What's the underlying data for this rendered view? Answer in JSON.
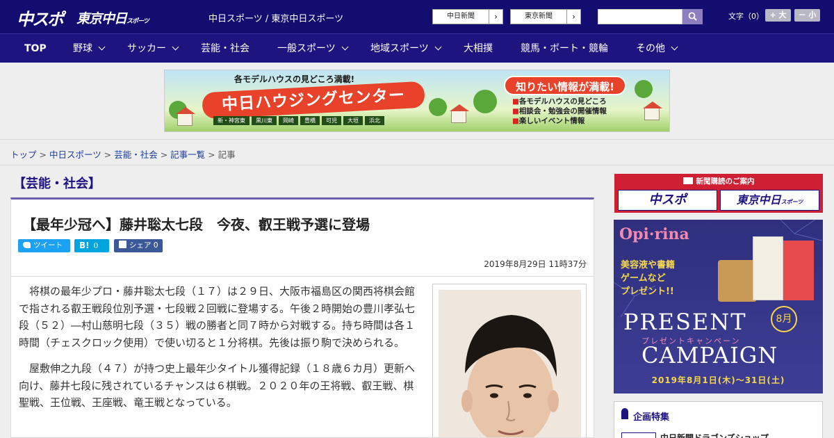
{
  "header": {
    "logo_main": "中スポ",
    "logo_tokyo": "東京中日",
    "logo_tokyo_small": "スポーツ",
    "site_names": "中日スポーツ / 東京中日スポーツ",
    "ext_links": [
      {
        "label": "中日新聞"
      },
      {
        "label": "東京新聞"
      }
    ],
    "search": {
      "value": "",
      "placeholder": ""
    },
    "font_size_label": "文字（0）",
    "font_up": "+ 大",
    "font_down": "－ 小"
  },
  "nav": {
    "items": [
      {
        "label": "TOP"
      },
      {
        "label": "野球"
      },
      {
        "label": "サッカー"
      },
      {
        "label": "芸能・社会"
      },
      {
        "label": "一般スポーツ"
      },
      {
        "label": "地域スポーツ"
      },
      {
        "label": "大相撲"
      },
      {
        "label": "競馬・ボート・競輪"
      },
      {
        "label": "その他"
      }
    ]
  },
  "banner": {
    "top_text": "各モデルハウスの見どころ満載!",
    "main_text": "中日ハウジングセンター",
    "areas": [
      "新・神宮東",
      "黒川東",
      "岡崎",
      "豊橋",
      "可児",
      "大垣",
      "浜北"
    ],
    "bubble": "知りたい情報が満載!",
    "features": [
      "各モデルハウスの見どころ",
      "相談会・勉強会の開催情報",
      "楽しいイベント情報"
    ]
  },
  "breadcrumb": {
    "items": [
      "トップ",
      "中日スポーツ",
      "芸能・社会",
      "記事一覧"
    ],
    "current": "記事",
    "separator": ">"
  },
  "category_title": "【芸能・社会】",
  "article": {
    "title": "【最年少冠へ】藤井聡太七段　今夜、叡王戦予選に登場",
    "share": {
      "tweet": "ツイート",
      "hatena_label": "B!",
      "hatena_count": "0",
      "facebook": "シェア 0"
    },
    "date": "2019年8月29日 11時37分",
    "paragraphs": [
      "将棋の最年少プロ・藤井聡太七段（１７）は２９日、大阪市福島区の関西将棋会館で指される叡王戦段位別予選・七段戦２回戦に登場する。午後２時開始の豊川孝弘七段（５２）―村山慈明七段（３５）戦の勝者と同７時から対戦する。持ち時間は各１時間（チェスクロック使用）で使い切ると１分将棋。先後は振り駒で決められる。",
      "屋敷伸之九段（４７）が持つ史上最年少タイトル獲得記録（１８歳６カ月）更新へ向け、藤井七段に残されているチャンスは６棋戦。２０２０年の王将戦、叡王戦、棋聖戦、王位戦、王座戦、竜王戦となっている。"
    ]
  },
  "sidebar": {
    "subscription": {
      "head": "新聞購読のご案内",
      "logo1": "中スポ",
      "logo2": "東京中日",
      "logo2_small": "スポーツ"
    },
    "ad": {
      "brand": "Opi·rina",
      "gift_lines": [
        "美容液や書籍",
        "ゲームなど",
        "プレゼント!!"
      ],
      "present": "PRESENT",
      "sub": "プレゼントキャンペーン",
      "campaign": "CAMPAIGN",
      "month": "8月",
      "date_range": "2019年8月1日(木)～31日(土)"
    },
    "feature": {
      "title": "企画特集",
      "item": "中日新聞ドラゴンズショップ"
    }
  },
  "colors": {
    "header_bg": "#120d6e",
    "nav_bg": "#1d1480",
    "accent": "#6a5faa",
    "twitter": "#1da1f2",
    "hatena": "#00a4de",
    "facebook": "#3b5998",
    "subscription": "#cf1f32"
  }
}
